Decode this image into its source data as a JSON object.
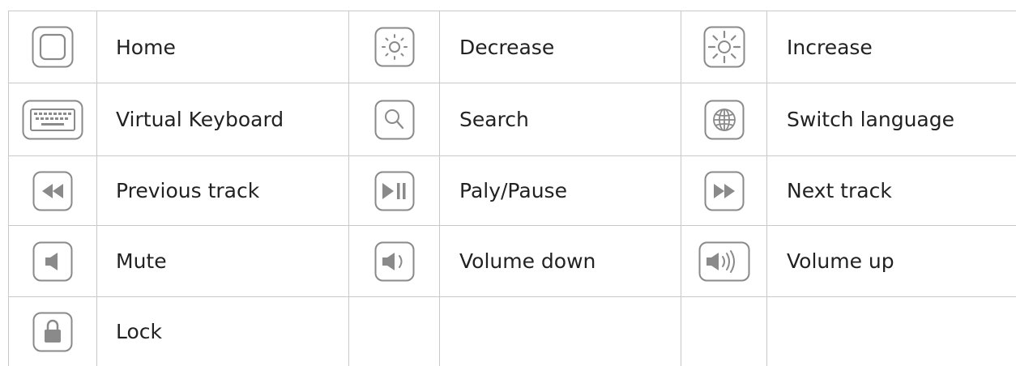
{
  "rows": [
    [
      {
        "icon": "home-icon",
        "label": "Home"
      },
      {
        "icon": "brightness-decrease-icon",
        "label": "Decrease"
      },
      {
        "icon": "brightness-increase-icon",
        "label": "Increase"
      }
    ],
    [
      {
        "icon": "keyboard-icon",
        "label": "Virtual Keyboard"
      },
      {
        "icon": "search-icon",
        "label": "Search"
      },
      {
        "icon": "globe-icon",
        "label": "Switch language"
      }
    ],
    [
      {
        "icon": "previous-track-icon",
        "label": "Previous track"
      },
      {
        "icon": "play-pause-icon",
        "label": "Paly/Pause"
      },
      {
        "icon": "next-track-icon",
        "label": "Next track"
      }
    ],
    [
      {
        "icon": "mute-icon",
        "label": "Mute"
      },
      {
        "icon": "volume-down-icon",
        "label": "Volume down"
      },
      {
        "icon": "volume-up-icon",
        "label": "Volume up"
      }
    ],
    [
      {
        "icon": "lock-icon",
        "label": "Lock"
      },
      {
        "icon": "",
        "label": ""
      },
      {
        "icon": "",
        "label": ""
      }
    ]
  ],
  "colors": {
    "grid": "#c9c9c9",
    "icon_stroke": "#8a8a8a",
    "icon_fill": "#8a8a8a",
    "text": "#222222"
  }
}
